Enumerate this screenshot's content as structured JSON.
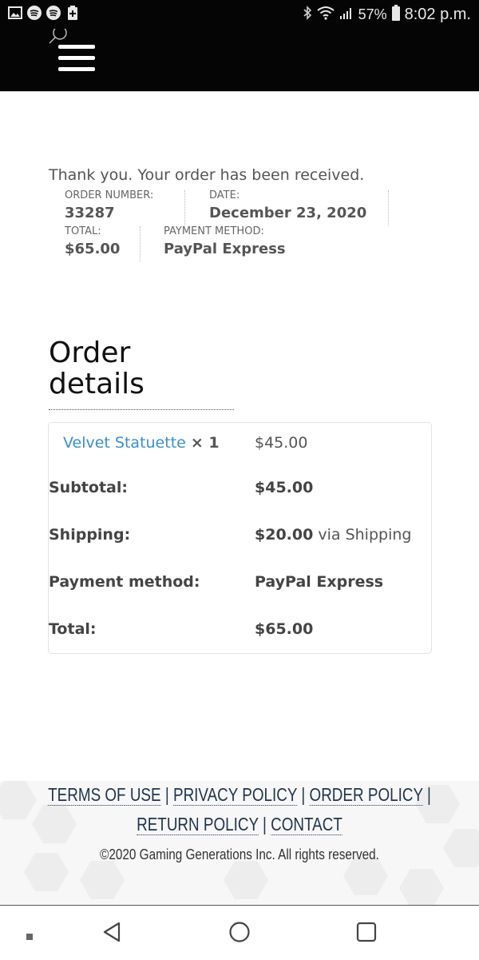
{
  "status_bar": {
    "battery": "57%",
    "time": "8:02 p.m."
  },
  "order_received": {
    "thanks": "Thank you. Your order has been received.",
    "order_number_label": "ORDER NUMBER:",
    "order_number": "33287",
    "date_label": "DATE:",
    "date": "December 23, 2020",
    "total_label": "TOTAL:",
    "total": "$65.00",
    "payment_method_label": "PAYMENT METHOD:",
    "payment_method": "PayPal Express"
  },
  "order_details": {
    "title_line1": "Order",
    "title_line2": "details",
    "product": {
      "name": "Velvet Statuette",
      "quantity": "× 1",
      "price": "$45.00"
    },
    "subtotal_label": "Subtotal:",
    "subtotal": "$45.00",
    "shipping_label": "Shipping:",
    "shipping_amount": "$20.00",
    "shipping_method": "via Shipping",
    "payment_method_label": "Payment method:",
    "payment_method": "PayPal Express",
    "total_label": "Total:",
    "total": "$65.00"
  },
  "footer": {
    "links": [
      "TERMS OF USE",
      "PRIVACY POLICY",
      "ORDER POLICY",
      "RETURN POLICY",
      "CONTACT"
    ],
    "separator": "|",
    "copyright": "©2020 Gaming Generations Inc. All rights reserved."
  },
  "colors": {
    "header_bg": "#050505",
    "link_blue": "#3a8fd0",
    "footer_link": "#1f3350"
  }
}
